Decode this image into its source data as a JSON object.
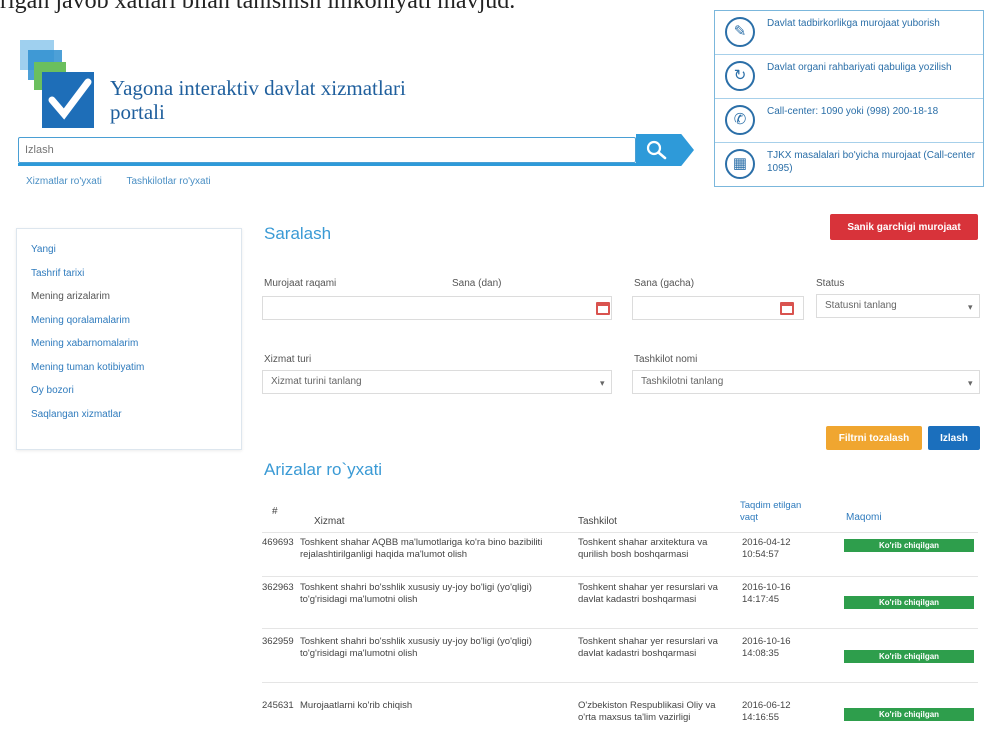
{
  "caption": "rigan javob xatlari bilan tanishish imkoniyati mavjud.",
  "header": {
    "title": "Yagona interaktiv davlat xizmatlari portali"
  },
  "info_box": [
    {
      "icon": "document-edit-icon",
      "text": "Davlat tadbirkorlikga murojaat yuborish"
    },
    {
      "icon": "refresh-icon",
      "text": "Davlat organi rahbariyati qabuliga yozilish"
    },
    {
      "icon": "phone-icon",
      "text": "Call-center: 1090 yoki (998) 200-18-18"
    },
    {
      "icon": "building-icon",
      "text": "TJKX masalalari bo'yicha murojaat (Call-center 1095)"
    }
  ],
  "search": {
    "placeholder": "Izlash",
    "links": [
      "Xizmatlar ro'yxati",
      "Tashkilotlar ro'yxati"
    ]
  },
  "sidebar": {
    "items": [
      {
        "label": "Yangi",
        "active": false
      },
      {
        "label": "Tashrif tarixi",
        "active": false
      },
      {
        "label": "Mening arizalarim",
        "active": true
      },
      {
        "label": "Mening qoralamalarim",
        "active": false
      },
      {
        "label": "Mening xabarnomalarim",
        "active": false
      },
      {
        "label": "Mening tuman kotibiyatim",
        "active": false
      },
      {
        "label": "Oy bozori",
        "active": false
      },
      {
        "label": "Saqlangan xizmatlar",
        "active": false
      }
    ]
  },
  "filter": {
    "title": "Saralash",
    "new_request_button": "Sanik garchigi murojaat",
    "fields": {
      "request_number": {
        "label": "Murojaat raqami",
        "value": ""
      },
      "date_from": {
        "label": "Sana (dan)",
        "value": ""
      },
      "date_to": {
        "label": "Sana (gacha)",
        "value": ""
      },
      "status": {
        "label": "Status",
        "value": "Statusni tanlang"
      },
      "service_type": {
        "label": "Xizmat turi",
        "value": "Xizmat turini tanlang"
      },
      "organization": {
        "label": "Tashkilot nomi",
        "value": "Tashkilotni tanlang"
      }
    },
    "clear_button": "Filtrni tozalash",
    "search_button": "Izlash"
  },
  "requests": {
    "title": "Arizalar ro`yxati",
    "columns": [
      "#",
      "Xizmat",
      "Tashkilot",
      "Taqdim etilgan vaqt",
      "Maqomi"
    ],
    "rows": [
      {
        "id": "469693",
        "service": "Toshkent shahar AQBB ma'lumotlariga ko'ra bino bazibiliti rejalashtirilganligi haqida ma'lumot olish",
        "org": "Toshkent shahar arxitektura va qurilish bosh boshqarmasi",
        "time": "2016-04-12 10:54:57",
        "status": "Ko'rib chiqilgan"
      },
      {
        "id": "362963",
        "service": "Toshkent shahri bo'sshlik xususiy uy-joy bo'ligi (yo'qligi) to'g'risidagi ma'lumotni olish",
        "org": "Toshkent shahar yer resurslari va davlat kadastri boshqarmasi",
        "time": "2016-10-16 14:17:45",
        "status": "Ko'rib chiqilgan"
      },
      {
        "id": "362959",
        "service": "Toshkent shahri bo'sshlik xususiy uy-joy bo'ligi (yo'qligi) to'g'risidagi ma'lumotni olish",
        "org": "Toshkent shahar yer resurslari va davlat kadastri boshqarmasi",
        "time": "2016-10-16 14:08:35",
        "status": "Ko'rib chiqilgan"
      },
      {
        "id": "245631",
        "service": "Murojaatlarni ko'rib chiqish",
        "org": "O'zbekiston Respublikasi Oliy va o'rta maxsus ta'lim vazirligi",
        "time": "2016-06-12 14:16:55",
        "status": "Ko'rib chiqilgan"
      }
    ]
  },
  "colors": {
    "primary": "#2e9ad9",
    "link": "#2f7bbd",
    "danger": "#d8333a",
    "warning": "#f0a630",
    "success": "#2e9e4c"
  }
}
